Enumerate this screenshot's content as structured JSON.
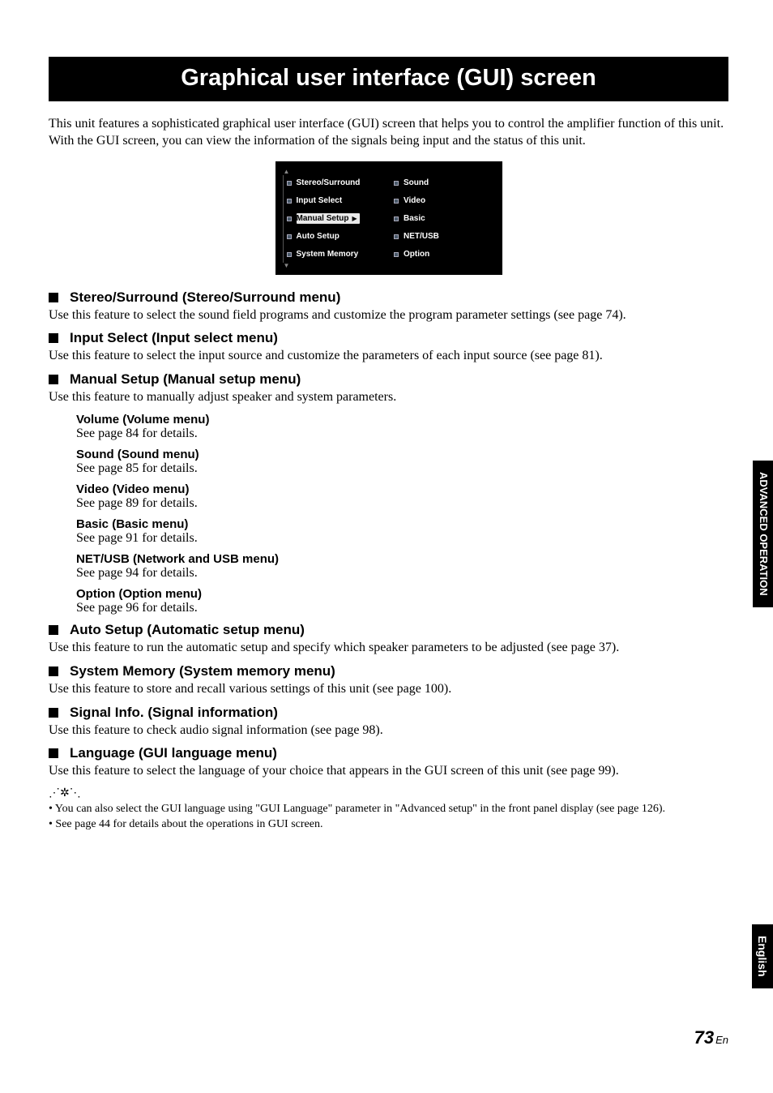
{
  "title": "Graphical user interface (GUI) screen",
  "intro": "This unit features a sophisticated graphical user interface (GUI) screen that helps you to control the amplifier function of this unit. With the GUI screen, you can view the information of the signals being input and the status of this unit.",
  "gui": {
    "left": [
      "Stereo/Surround",
      "Input Select",
      "Manual Setup",
      "Auto Setup",
      "System Memory"
    ],
    "right": [
      "Sound",
      "Video",
      "Basic",
      "NET/USB",
      "Option"
    ]
  },
  "sections": {
    "stereo": {
      "title": "Stereo/Surround (Stereo/Surround menu)",
      "desc": "Use this feature to select the sound field programs and customize the program parameter settings (see page 74)."
    },
    "input": {
      "title": "Input Select (Input select menu)",
      "desc": "Use this feature to select the input source and customize the parameters of each input source (see page 81)."
    },
    "manual": {
      "title": "Manual Setup (Manual setup menu)",
      "desc": "Use this feature to manually adjust speaker and system parameters.",
      "items": [
        {
          "h": "Volume (Volume menu)",
          "d": "See page 84 for details."
        },
        {
          "h": "Sound (Sound menu)",
          "d": "See page 85 for details."
        },
        {
          "h": "Video (Video menu)",
          "d": "See page 89 for details."
        },
        {
          "h": "Basic (Basic menu)",
          "d": "See page 91 for details."
        },
        {
          "h": "NET/USB (Network and USB menu)",
          "d": "See page 94 for details."
        },
        {
          "h": "Option (Option menu)",
          "d": "See page 96 for details."
        }
      ]
    },
    "auto": {
      "title": "Auto Setup (Automatic setup menu)",
      "desc": "Use this feature to run the automatic setup and specify which speaker parameters to be adjusted (see page 37)."
    },
    "sysmem": {
      "title": "System Memory (System memory menu)",
      "desc": "Use this feature to store and recall various settings of this unit (see page 100)."
    },
    "signal": {
      "title": "Signal Info. (Signal information)",
      "desc": "Use this feature to check audio signal information (see page 98)."
    },
    "lang": {
      "title": "Language (GUI language menu)",
      "desc": "Use this feature to select the language of your choice that appears in the GUI screen of this unit (see page 99)."
    }
  },
  "notes": [
    "You can also select the GUI language using \"GUI Language\" parameter in \"Advanced setup\" in the front panel display (see page 126).",
    "See page 44 for details about the operations in GUI screen."
  ],
  "sidetabs": {
    "advanced": "ADVANCED\nOPERATION",
    "english": "English"
  },
  "page": {
    "num": "73",
    "suffix": "En"
  }
}
